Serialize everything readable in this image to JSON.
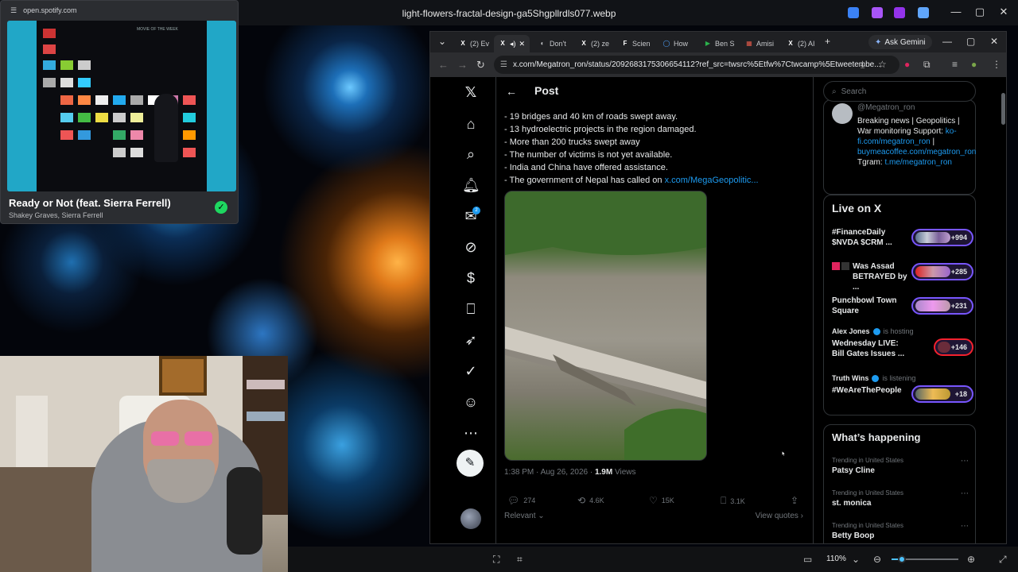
{
  "window": {
    "title": "light-flowers-fractal-design-ga5Shgpllrdls077.webp",
    "minimize": "—",
    "maximize": "▢",
    "close": "✕"
  },
  "spotify": {
    "url": "open.spotify.com",
    "art_text": "MOVIE OF THE WEEK",
    "track_title": "Ready or Not (feat. Sierra Ferrell)",
    "artists": "Shakey Graves, Sierra Ferrell",
    "saved_glyph": "✓"
  },
  "browser": {
    "tabs": [
      {
        "icon": "X",
        "label": "(2) Ev",
        "color": "#000000"
      },
      {
        "icon": "X",
        "label": "",
        "color": "#000000"
      },
      {
        "icon": "◐",
        "label": "Don't",
        "color": "#5c4bbd"
      },
      {
        "icon": "X",
        "label": "(2) ze",
        "color": "#000000"
      },
      {
        "icon": "F",
        "label": "Scien",
        "color": "#000000"
      },
      {
        "icon": "◯",
        "label": "How",
        "color": "#1a73e8"
      },
      {
        "icon": "▶",
        "label": "Ben S",
        "color": "#2bb24c"
      },
      {
        "icon": "▦",
        "label": "Amisi",
        "color": "#c0392b"
      },
      {
        "icon": "X",
        "label": "(2) AI",
        "color": "#000000"
      }
    ],
    "new_tab": "+",
    "ask_gemini": "Ask Gemini",
    "url": "x.com/Megatron_ron/status/2092683175306654112?ref_src=twsrc%5Etfw%7Ctwcamp%5Etweetembe..."
  },
  "x": {
    "post_title": "Post",
    "bullets": [
      "- 19 bridges and 40 km of roads swept away.",
      "- 13 hydroelectric projects in the region damaged.",
      "- More than 200 trucks swept away",
      "- The number of victims is not yet available.",
      "- India and China have offered assistance."
    ],
    "bullet_last_prefix": "- The government of Nepal has called on ",
    "bullet_last_link": "x.com/MegaGeopolitic...",
    "image_alt": "flooded river with damaged bridge",
    "meta_time": "1:38 PM · Aug 26, 2026 · ",
    "meta_views_count": "1.9M",
    "meta_views_label": " Views",
    "actions": {
      "replies": "274",
      "reposts": "4.6K",
      "likes": "15K",
      "bookmarks": "3.1K"
    },
    "relevant": "Relevant",
    "view_quotes": "View quotes",
    "notif_count": "2",
    "search_placeholder": "Search",
    "bio": {
      "handle": "@Megatron_ron",
      "line1": "Breaking news | Geopolitics | War monitoring Support: ",
      "link1": "ko-fi.com/megatron_ron",
      "sep": " | ",
      "link2": "buymeacoffee.com/megatron_ron",
      "tgram": " Tgram: ",
      "link3": "t.me/megatron_ron"
    },
    "live_title": "Live on X",
    "live": [
      {
        "name": "#FinanceDaily $NVDA $CRM ...",
        "count": "+994"
      },
      {
        "name": "Was Assad BETRAYED by ...",
        "count": "+285"
      },
      {
        "name": "Punchbowl Town Square",
        "count": "+231"
      },
      {
        "host": "Alex Jones",
        "role": "is hosting",
        "name": "Wednesday LIVE: Bill Gates Issues ...",
        "count": "+146"
      },
      {
        "host": "Truth Wins",
        "role": "is listening",
        "name": "#WeAreThePeople",
        "count": "+18"
      }
    ],
    "happening_title": "What’s happening",
    "trends": [
      {
        "meta": "Trending in United States",
        "name": "Patsy Cline"
      },
      {
        "meta": "Trending in United States",
        "name": "st. monica"
      },
      {
        "meta": "Trending in United States",
        "name": "Betty Boop"
      }
    ]
  },
  "bottombar": {
    "zoom": "110%",
    "zoom_fraction": 0.15
  }
}
